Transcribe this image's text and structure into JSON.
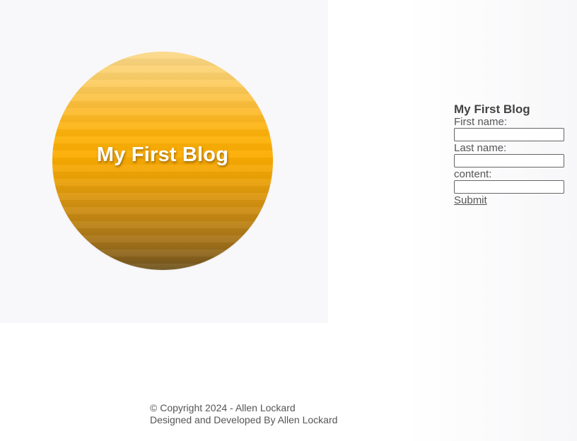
{
  "hero": {
    "title": "My First Blog"
  },
  "form": {
    "heading": "My First Blog",
    "first_name_label": "First name:",
    "first_name_value": "",
    "last_name_label": "Last name:",
    "last_name_value": "",
    "content_label": "content:",
    "content_value": "",
    "submit_label": "Submit"
  },
  "footer": {
    "copyright": "© Copyright 2024 - Allen Lockard",
    "credit": "Designed and Developed By Allen Lockard"
  },
  "colors": {
    "sun_top": "#fbd98b",
    "sun_middle": "#fcac00",
    "sun_bottom": "#6f5420",
    "text": "#555555"
  }
}
